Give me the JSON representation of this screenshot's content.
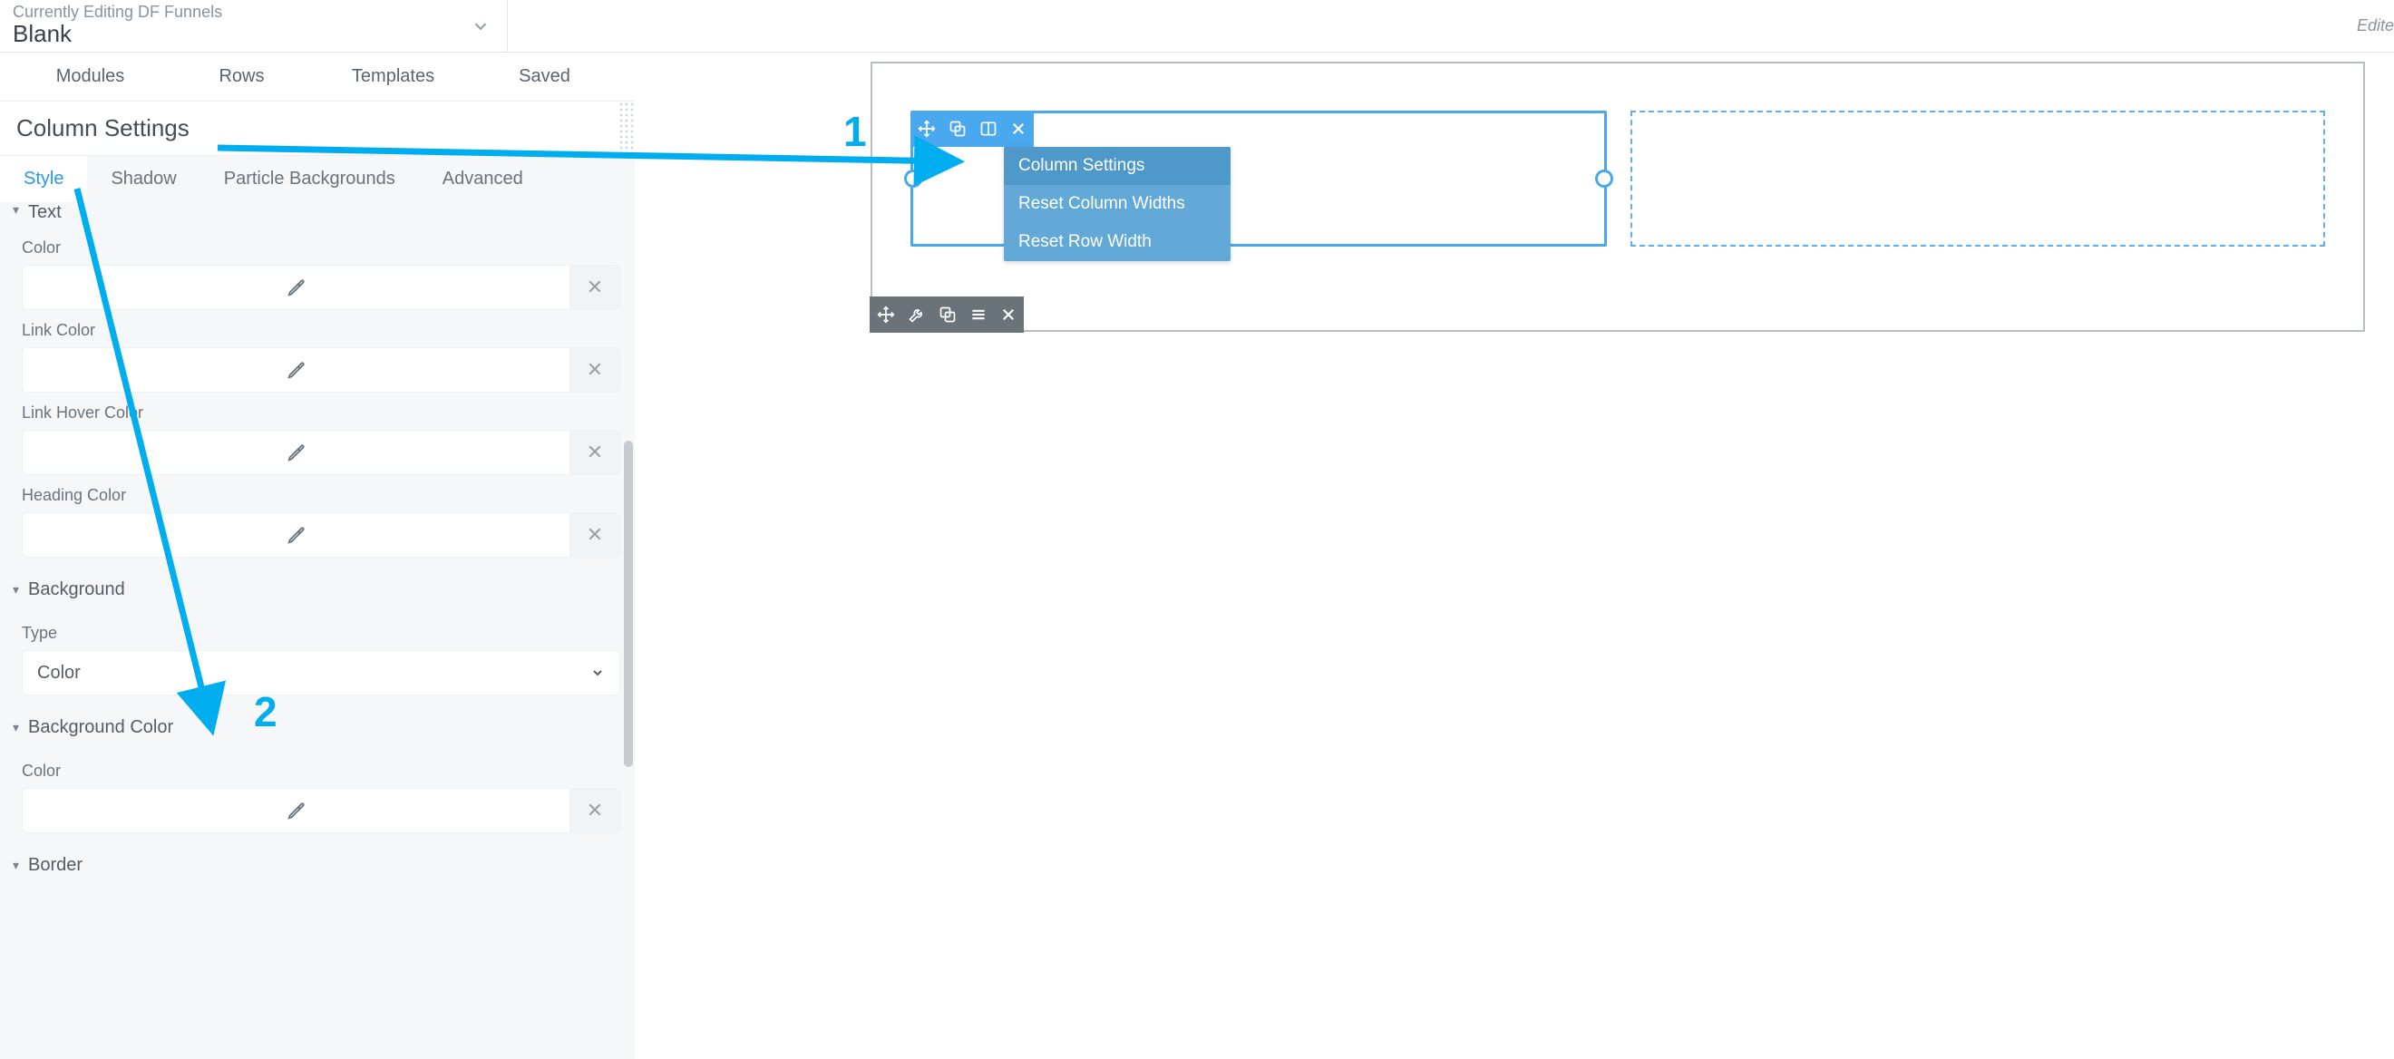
{
  "topbar": {
    "pretitle": "Currently Editing DF Funnels",
    "title": "Blank",
    "right_status": "Edite"
  },
  "sidebar": {
    "main_tabs": [
      "Modules",
      "Rows",
      "Templates",
      "Saved"
    ],
    "panel_title": "Column Settings",
    "sub_tabs": [
      {
        "label": "Style",
        "active": true
      },
      {
        "label": "Shadow",
        "active": false
      },
      {
        "label": "Particle Backgrounds",
        "active": false
      },
      {
        "label": "Advanced",
        "active": false
      }
    ],
    "sections": {
      "text": {
        "title": "Text",
        "fields": [
          {
            "label": "Color"
          },
          {
            "label": "Link Color"
          },
          {
            "label": "Link Hover Color"
          },
          {
            "label": "Heading Color"
          }
        ]
      },
      "background": {
        "title": "Background",
        "type_label": "Type",
        "type_value": "Color"
      },
      "background_color": {
        "title": "Background Color",
        "fields": [
          {
            "label": "Color"
          }
        ]
      },
      "border": {
        "title": "Border"
      }
    }
  },
  "canvas": {
    "column_toolbar_icons": [
      "move-icon",
      "copy-icon",
      "columns-icon",
      "close-icon"
    ],
    "column_dropdown": [
      "Column Settings",
      "Reset Column Widths",
      "Reset Row Width"
    ],
    "column_dropdown_active_index": 0,
    "row_toolbar_icons": [
      "move-icon",
      "wrench-icon",
      "copy-icon",
      "menu-icon",
      "close-icon"
    ]
  },
  "annotations": {
    "n1": "1",
    "n2": "2"
  },
  "colors": {
    "accent": "#00aeef"
  }
}
